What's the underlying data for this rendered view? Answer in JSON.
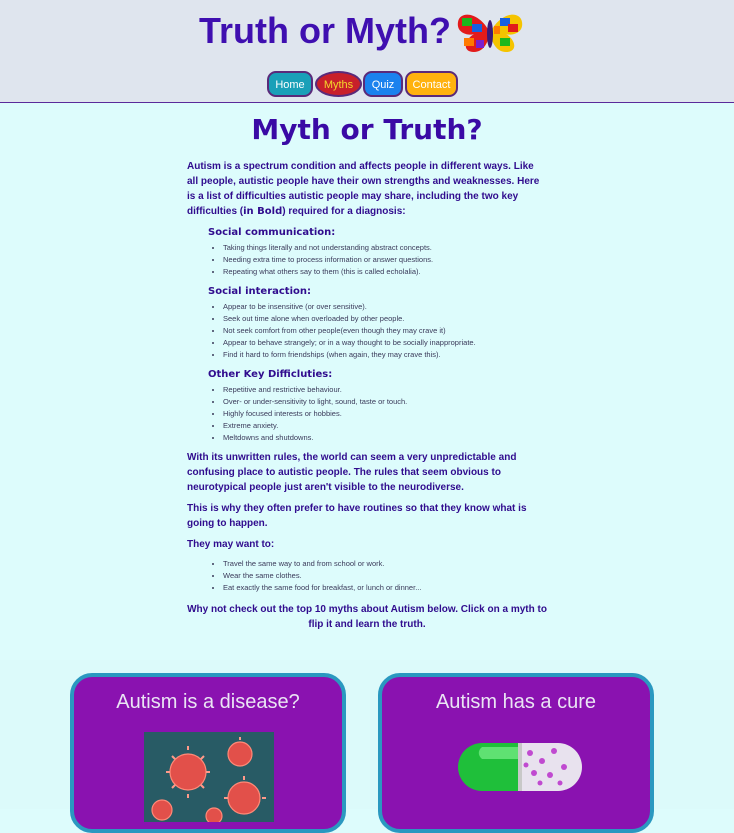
{
  "header": {
    "title": "Truth or Myth?",
    "nav": [
      "Home",
      "Myths",
      "Quiz",
      "Contact"
    ]
  },
  "main": {
    "heading": "Myth or Truth?",
    "intro_before_bold": "Autism is a spectrum condition and affects people in different ways. Like all people, autistic people have their own strengths and weaknesses. Here is a list of difficulties autistic people may share, including the two key difficulties (",
    "intro_bold": "in Bold",
    "intro_after_bold": ") required for a diagnosis:",
    "sections": [
      {
        "title": "Social communication:",
        "items": [
          "Taking things literally and not understanding abstract concepts.",
          "Needing extra time to process information or answer questions.",
          "Repeating what others say to them (this is called echolalia)."
        ]
      },
      {
        "title": "Social interaction:",
        "items": [
          "Appear to be insensitive (or over sensitive).",
          "Seek out time alone when overloaded by other people.",
          "Not seek comfort from other people(even though they may crave it)",
          "Appear to behave strangely; or in a way thought to be socially inappropriate.",
          "Find it hard to form friendships (when again, they may crave this)."
        ]
      },
      {
        "title": "Other Key Difficluties:",
        "items": [
          "Repetitive and restrictive behaviour.",
          "Over- or under-sensitivity to light, sound, taste or touch.",
          "Highly focused interests or hobbies.",
          "Extreme anxiety.",
          "Meltdowns and shutdowns."
        ]
      }
    ],
    "para_world": "With its unwritten rules, the world can seem a very unpredictable and confusing place to autistic people. The rules that seem obvious to neurotypical people just aren't visible to the neurodiverse.",
    "para_routines": "This is why they often prefer to have routines so that they know what is going to happen.",
    "para_may_want": "They may want to:",
    "may_want_items": [
      "Travel the same way to and from school or work.",
      "Wear the same clothes.",
      "Eat exactly the same food for breakfast, or lunch or dinner..."
    ],
    "cta": "Why not check out the top 10 myths about Autism below. Click on a myth to flip it and learn the truth."
  },
  "cards": [
    {
      "title": "Autism is a disease?"
    },
    {
      "title": "Autism has a cure"
    }
  ],
  "colors": {
    "page_bg": "#ddfcfc",
    "header_bg": "#dfe5ee",
    "title": "#3f0fb0",
    "card_bg": "#8a12b0",
    "card_border": "#2a98c0"
  }
}
